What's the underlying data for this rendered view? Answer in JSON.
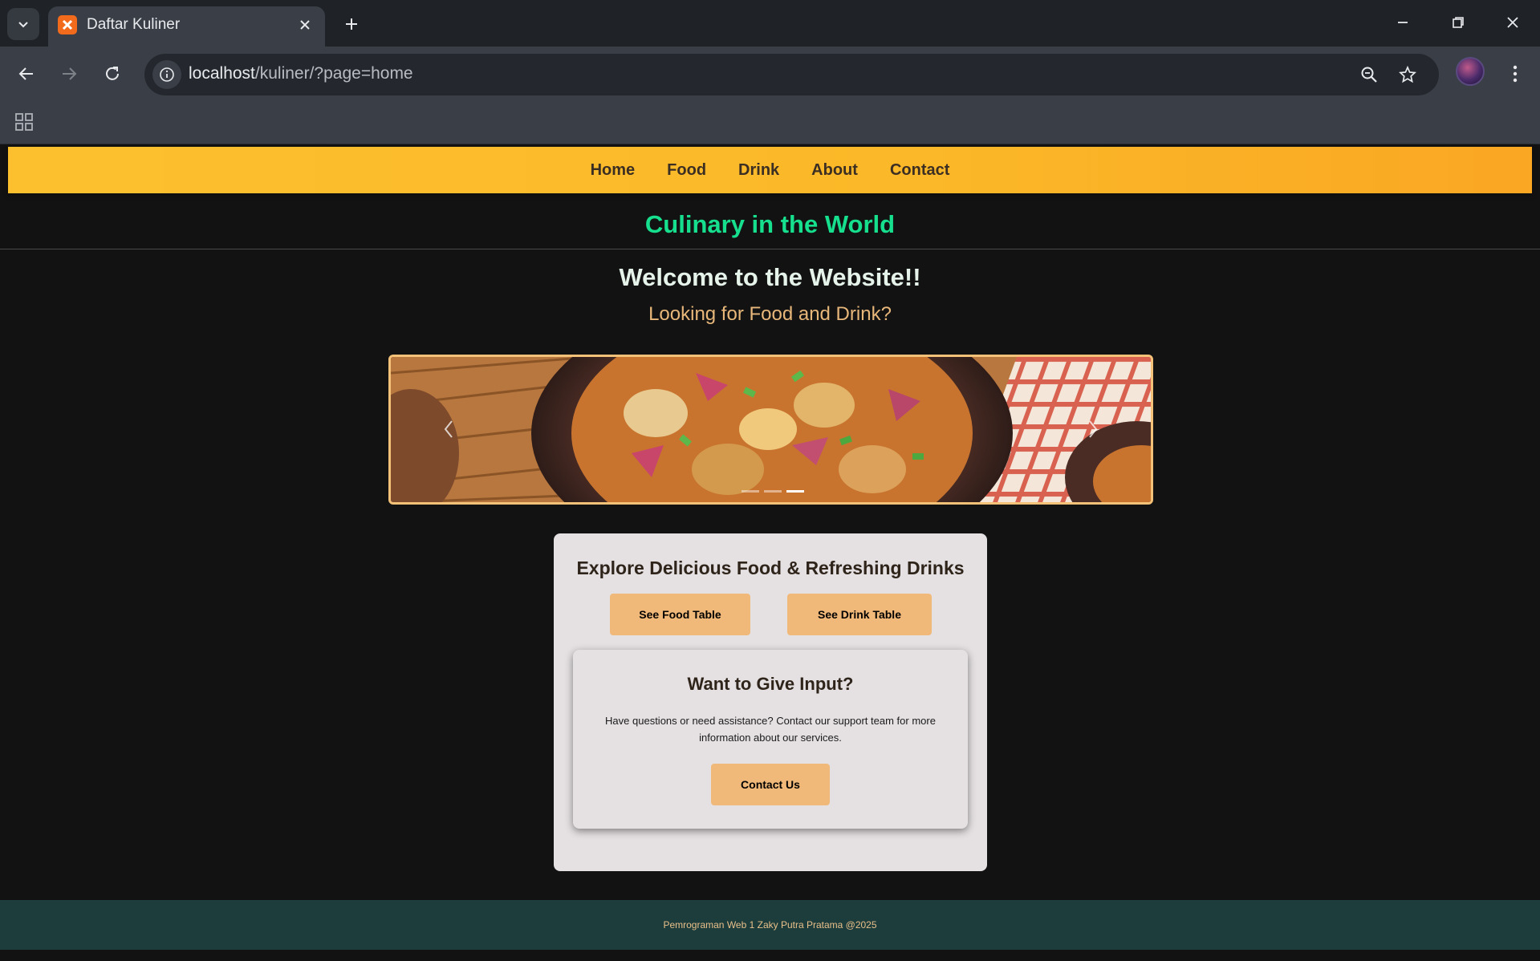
{
  "browser": {
    "tab_title": "Daftar Kuliner",
    "url_host": "localhost",
    "url_path": "/kuliner/?page=home"
  },
  "site": {
    "nav": [
      "Home",
      "Food",
      "Drink",
      "About",
      "Contact"
    ],
    "title": "Culinary in the World",
    "welcome": "Welcome to the Website!!",
    "subtitle": "Looking for Food and Drink?",
    "carousel": {
      "slide_count": 3,
      "active_index": 2
    },
    "explore": {
      "title": "Explore Delicious Food & Refreshing Drinks",
      "food_button": "See Food Table",
      "drink_button": "See Drink Table"
    },
    "input": {
      "title": "Want to Give Input?",
      "text": "Have questions or need assistance? Contact our support team for more information about our services.",
      "button": "Contact Us"
    },
    "footer": "Pemrograman Web 1 Zaky Putra Pratama @2025"
  },
  "colors": {
    "nav_bar": "#fbb828",
    "title_green": "#16e08e",
    "button": "#f1b979",
    "footer_bg": "#1d3c3c"
  }
}
